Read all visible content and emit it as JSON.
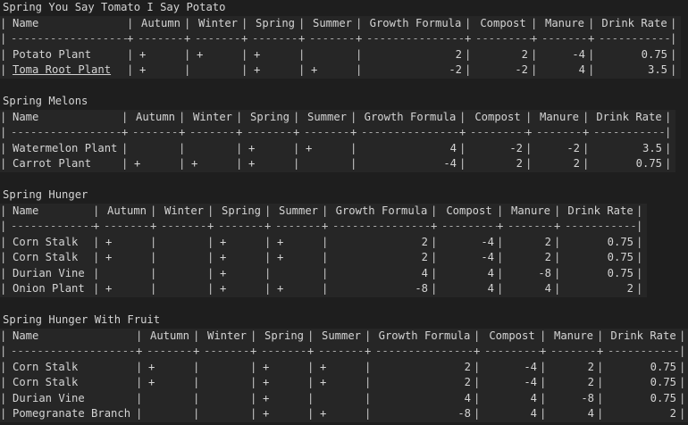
{
  "columns": [
    "Name",
    "Autumn",
    "Winter",
    "Spring",
    "Summer",
    "Growth Formula",
    "Compost",
    "Manure",
    "Drink Rate"
  ],
  "tables": [
    {
      "title": "Spring You Say Tomato I Say Potato",
      "rows": [
        [
          "Potato Plant",
          "+",
          "+",
          "+",
          "",
          "2",
          "2",
          "-4",
          "0.75"
        ],
        [
          "Toma Root Plant",
          "+",
          "",
          "+",
          "+",
          "-2",
          "-2",
          "4",
          "3.5"
        ]
      ]
    },
    {
      "title": "Spring Melons",
      "rows": [
        [
          "Watermelon Plant",
          "",
          "",
          "+",
          "+",
          "4",
          "-2",
          "-2",
          "3.5"
        ],
        [
          "Carrot Plant",
          "+",
          "+",
          "+",
          "",
          "-4",
          "2",
          "2",
          "0.75"
        ]
      ]
    },
    {
      "title": "Spring Hunger",
      "rows": [
        [
          "Corn Stalk",
          "+",
          "",
          "+",
          "+",
          "2",
          "-4",
          "2",
          "0.75"
        ],
        [
          "Corn Stalk",
          "+",
          "",
          "+",
          "+",
          "2",
          "-4",
          "2",
          "0.75"
        ],
        [
          "Durian Vine",
          "",
          "",
          "+",
          "",
          "4",
          "4",
          "-8",
          "0.75"
        ],
        [
          "Onion Plant",
          "+",
          "",
          "+",
          "+",
          "-8",
          "4",
          "4",
          "2"
        ]
      ]
    },
    {
      "title": "Spring Hunger With Fruit",
      "rows": [
        [
          "Corn Stalk",
          "+",
          "",
          "+",
          "+",
          "2",
          "-4",
          "2",
          "0.75"
        ],
        [
          "Corn Stalk",
          "+",
          "",
          "+",
          "+",
          "2",
          "-4",
          "2",
          "0.75"
        ],
        [
          "Durian Vine",
          "",
          "",
          "+",
          "",
          "4",
          "4",
          "-8",
          "0.75"
        ],
        [
          "Pomegranate Branch",
          "",
          "",
          "+",
          "+",
          "-8",
          "4",
          "4",
          "2"
        ]
      ]
    }
  ]
}
